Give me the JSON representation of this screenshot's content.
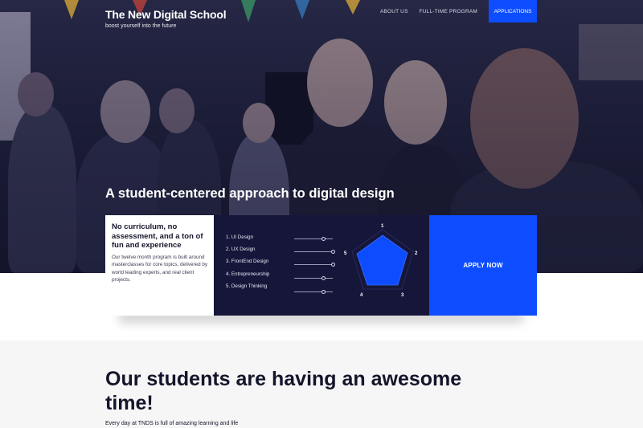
{
  "header": {
    "logo": "The New Digital School",
    "tagline": "boost yourself into the future",
    "nav": [
      "ABOUT US",
      "FULL-TIME PROGRAM"
    ],
    "nav_cta": "APPLICATIONS"
  },
  "hero": {
    "title": "A student-centered approach to digital design"
  },
  "card": {
    "intro_title": "No curriculum, no assessment, and a ton of fun and experience",
    "intro_text": "Our twelve month program is built around masterclasses for core topics, delivered by world leading experts, and real client projects.",
    "topics": [
      "1. UI Design",
      "2. UX Design",
      "3. FrontEnd Design",
      "4. Entrepreneurship",
      "5. Design Thinking"
    ],
    "topic_levels": [
      0.75,
      1.0,
      1.0,
      0.75,
      0.75
    ],
    "radar_labels": [
      "1",
      "2",
      "3",
      "4",
      "5"
    ],
    "cta": "APPLY NOW"
  },
  "lower": {
    "heading": "Our students are having an awesome time!",
    "text": "Every day at TNDS is full of amazing learning and life"
  },
  "colors": {
    "accent": "#0e4dff",
    "navy": "#15163a",
    "dark_text": "#14152a"
  }
}
